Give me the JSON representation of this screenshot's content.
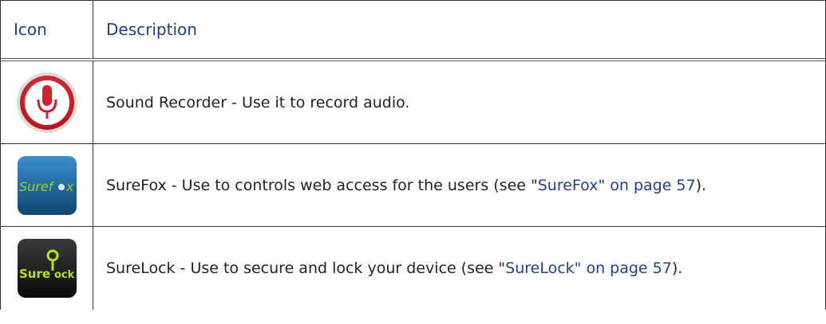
{
  "table": {
    "headers": {
      "icon": "Icon",
      "description": "Description"
    },
    "rows": [
      {
        "icon": "microphone-icon",
        "text": "Sound Recorder - Use it to record audio.",
        "link": "",
        "after": ""
      },
      {
        "icon": "surefox-icon",
        "icon_text_left": "Suref",
        "icon_text_right": "x",
        "text": "SureFox - Use to controls web access for the users (see \"",
        "link": "SureFox\" on page 57",
        "after": ")."
      },
      {
        "icon": "surelock-icon",
        "icon_text_left": "Sure",
        "icon_text_right": "ock",
        "text": "SureLock - Use to secure and lock your device (see \"",
        "link": "SureLock\" on page 57",
        "after": ")."
      }
    ]
  },
  "colors": {
    "header_text": "#1f3f8f",
    "link": "#1f3f8f",
    "recorder_red": "#c9232b",
    "surefox_blue": "#1f5f8f",
    "surefox_green": "#8fd13a",
    "surelock_green": "#b5e21e"
  }
}
